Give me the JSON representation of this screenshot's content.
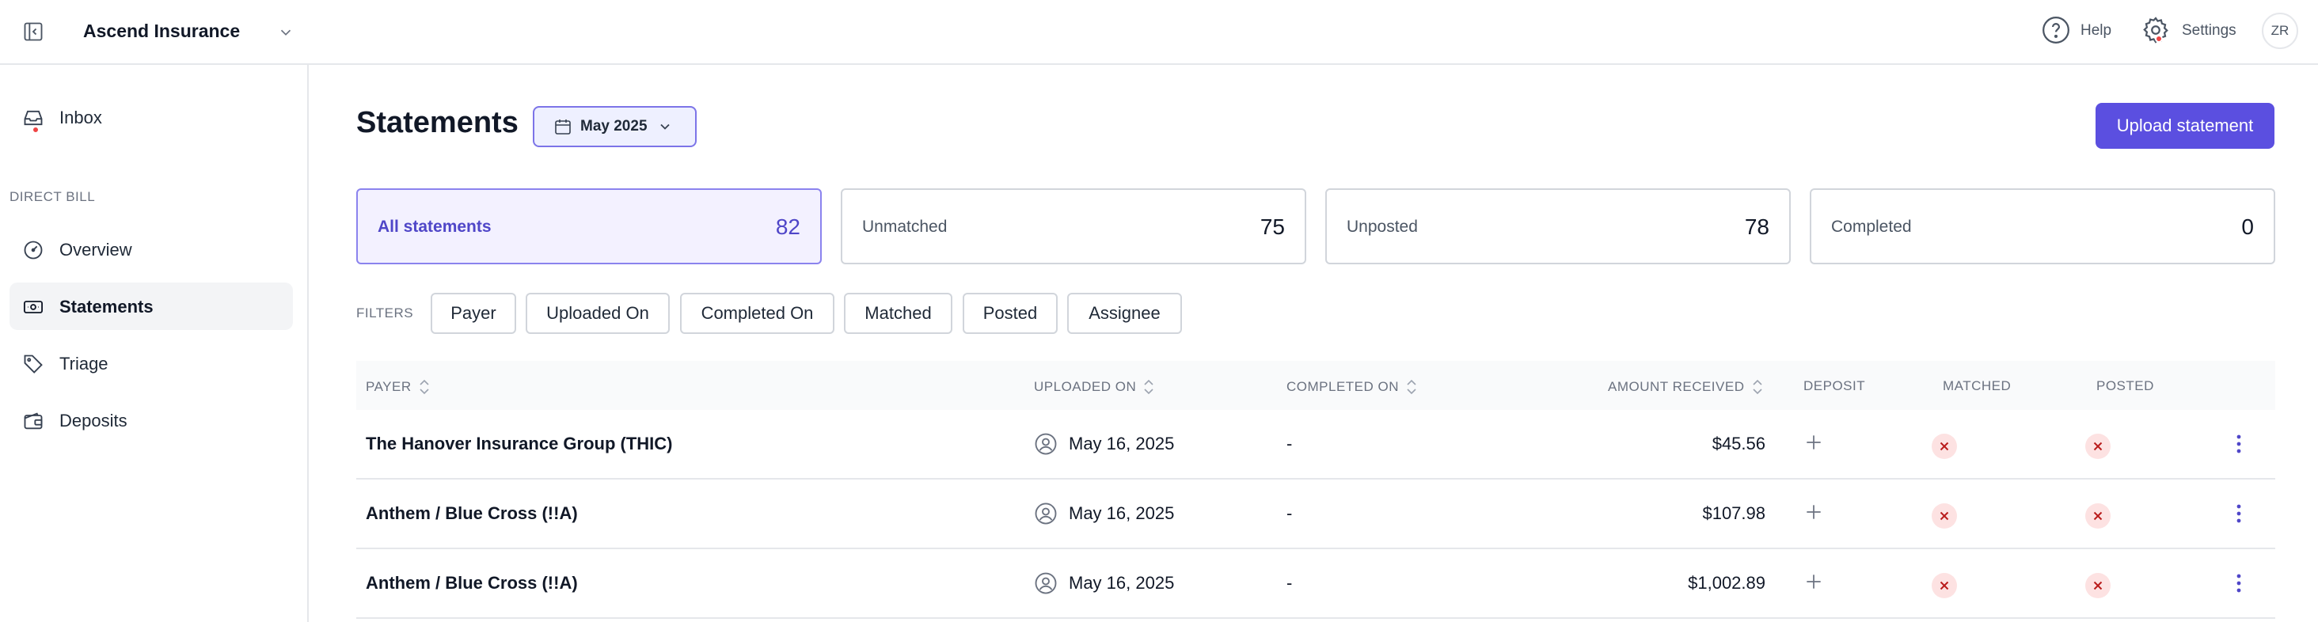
{
  "header": {
    "org_name": "Ascend Insurance",
    "help_label": "Help",
    "settings_label": "Settings",
    "avatar_initials": "ZR"
  },
  "sidebar": {
    "section_label": "DIRECT BILL",
    "items": [
      {
        "label": "Inbox",
        "icon": "inbox-icon",
        "has_notification": true
      },
      {
        "label": "Overview",
        "icon": "gauge-icon"
      },
      {
        "label": "Statements",
        "icon": "banknote-icon",
        "active": true
      },
      {
        "label": "Triage",
        "icon": "tag-icon"
      },
      {
        "label": "Deposits",
        "icon": "wallet-icon"
      }
    ]
  },
  "main": {
    "title": "Statements",
    "month_selector": "May 2025",
    "upload_button": "Upload statement",
    "cards": [
      {
        "label": "All statements",
        "count": "82",
        "active": true
      },
      {
        "label": "Unmatched",
        "count": "75"
      },
      {
        "label": "Unposted",
        "count": "78"
      },
      {
        "label": "Completed",
        "count": "0"
      }
    ],
    "filters_label": "FILTERS",
    "filters": [
      "Payer",
      "Uploaded On",
      "Completed On",
      "Matched",
      "Posted",
      "Assignee"
    ],
    "columns": {
      "payer": "PAYER",
      "uploaded_on": "UPLOADED ON",
      "completed_on": "COMPLETED ON",
      "amount_received": "AMOUNT RECEIVED",
      "deposit": "DEPOSIT",
      "matched": "MATCHED",
      "posted": "POSTED"
    },
    "rows": [
      {
        "payer": "The Hanover Insurance Group (THIC)",
        "uploaded_on": "May 16, 2025",
        "completed_on": "-",
        "amount": "$45.56"
      },
      {
        "payer": "Anthem / Blue Cross (!!A)",
        "uploaded_on": "May 16, 2025",
        "completed_on": "-",
        "amount": "$107.98"
      },
      {
        "payer": "Anthem / Blue Cross (!!A)",
        "uploaded_on": "May 16, 2025",
        "completed_on": "-",
        "amount": "$1,002.89"
      }
    ]
  },
  "colors": {
    "accent": "#5b4fe0",
    "notification": "#ef4444",
    "error_badge_bg": "#fde2e2",
    "error_badge_fg": "#b91c1c"
  }
}
